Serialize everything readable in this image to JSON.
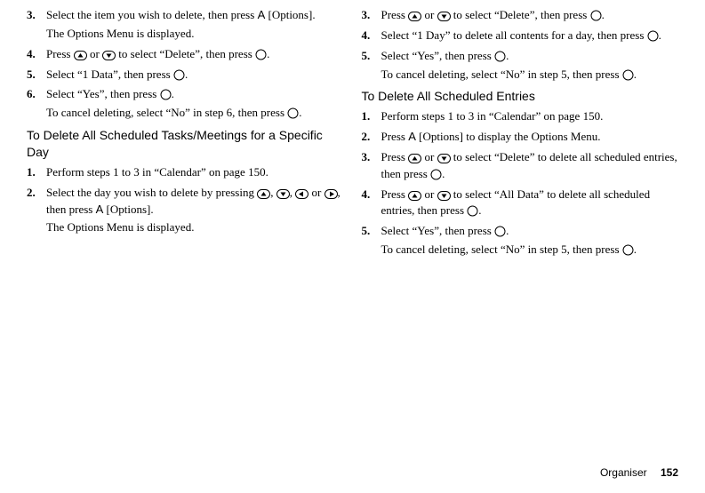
{
  "left": {
    "step3": {
      "num": "3.",
      "text_a": "Select the item you wish to delete, then press ",
      "key": "A",
      "text_b": " [Options].",
      "sub": "The Options Menu is displayed."
    },
    "step4": {
      "num": "4.",
      "text_a": "Press ",
      "text_b": " or ",
      "text_c": " to select “Delete”, then press ",
      "text_d": "."
    },
    "step5": {
      "num": "5.",
      "text_a": "Select “1 Data”, then press ",
      "text_b": "."
    },
    "step6": {
      "num": "6.",
      "text_a": "Select “Yes”, then press ",
      "text_b": ".",
      "sub_a": "To cancel deleting, select “No” in step 6, then press ",
      "sub_b": "."
    },
    "heading": "To Delete All Scheduled Tasks/Meetings for a Specific Day",
    "b_step1": {
      "num": "1.",
      "text": "Perform steps 1 to 3 in “Calendar” on page 150."
    },
    "b_step2": {
      "num": "2.",
      "text_a": "Select the day you wish to delete by pressing ",
      "text_b": ", ",
      "text_c": ", ",
      "text_d": " or ",
      "text_e": ", then press ",
      "key": "A",
      "text_f": " [Options].",
      "sub": "The Options Menu is displayed."
    }
  },
  "right": {
    "step3": {
      "num": "3.",
      "text_a": "Press ",
      "text_b": " or ",
      "text_c": " to select “Delete”, then press ",
      "text_d": "."
    },
    "step4": {
      "num": "4.",
      "text_a": "Select “1 Day” to delete all contents for a day, then press ",
      "text_b": "."
    },
    "step5": {
      "num": "5.",
      "text_a": "Select “Yes”, then press ",
      "text_b": ".",
      "sub_a": "To cancel deleting, select “No” in step 5, then press ",
      "sub_b": "."
    },
    "heading": "To Delete All Scheduled Entries",
    "c_step1": {
      "num": "1.",
      "text": "Perform steps 1 to 3 in “Calendar” on page 150."
    },
    "c_step2": {
      "num": "2.",
      "text_a": "Press ",
      "key": "A",
      "text_b": " [Options] to display the Options Menu."
    },
    "c_step3": {
      "num": "3.",
      "text_a": "Press ",
      "text_b": " or ",
      "text_c": " to select “Delete” to delete all scheduled entries, then press ",
      "text_d": "."
    },
    "c_step4": {
      "num": "4.",
      "text_a": "Press ",
      "text_b": " or ",
      "text_c": " to select “All Data” to delete all scheduled entries, then press ",
      "text_d": "."
    },
    "c_step5": {
      "num": "5.",
      "text_a": "Select “Yes”, then press ",
      "text_b": ".",
      "sub_a": "To cancel deleting, select “No” in step 5, then press ",
      "sub_b": "."
    }
  },
  "footer": {
    "section": "Organiser",
    "page": "152"
  }
}
